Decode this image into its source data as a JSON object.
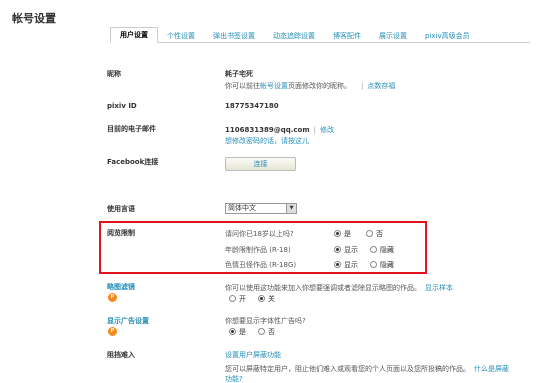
{
  "page_title": "帐号设置",
  "tabs": [
    {
      "label": "用户设置",
      "active": true
    },
    {
      "label": "个性设置"
    },
    {
      "label": "弹出书签设置"
    },
    {
      "label": "动态追踪设置"
    },
    {
      "label": "博客配件"
    },
    {
      "label": "展示设置"
    },
    {
      "label": "pixiv高级会员"
    }
  ],
  "nickname": {
    "label": "昵称",
    "value": "耗子宅死",
    "hint_prefix": "你可以前往",
    "hint_link": "帐号设置",
    "hint_suffix": "页面修改你的昵称。",
    "sep": "|",
    "register_link": "点数存福"
  },
  "pixiv_id": {
    "label": "pixiv ID",
    "value": "18775347180"
  },
  "email": {
    "label": "目前的电子邮件",
    "value": "1106831389@qq.com",
    "sep": "|",
    "edit_link": "修改",
    "forgot_link": "想修改密码的话，请按这儿"
  },
  "facebook": {
    "label": "Facebook连接",
    "button": "连接"
  },
  "language": {
    "label": "使用言语",
    "selected": "简体中文"
  },
  "content_restriction": {
    "label": "阅览限制",
    "rows": [
      {
        "question": "请问你已18岁以上吗?",
        "opt1": "是",
        "opt2": "否",
        "checked": 1
      },
      {
        "question": "年龄限制作品 (R-18)",
        "opt1": "显示",
        "opt2": "隐藏",
        "checked": 1
      },
      {
        "question": "色情丑怪作品 (R-18G)",
        "opt1": "显示",
        "opt2": "隐藏",
        "checked": 1
      }
    ]
  },
  "thumbnail_filter": {
    "label": "略图滤镜",
    "badge": "P",
    "text": "你可以使用这功能来加入你想要强调或者滤除显示略图的作品。",
    "sample_link": "显示样本",
    "opt1": "开",
    "opt2": "关",
    "checked": 2
  },
  "ad_display": {
    "label": "显示广告设置",
    "badge": "P",
    "text": "你想要显示字体性广告吗?",
    "opt1": "是",
    "opt2": "否",
    "checked": 1
  },
  "block_users": {
    "label": "阻挡难入",
    "setup_link": "设置用户屏蔽功能",
    "text": "您可以屏蔽特定用户，阻止他们难入或观看您的个人页面以及您所投稿的作品。",
    "what_link": "什么是屏蔽",
    "what_link2": "功能?"
  }
}
